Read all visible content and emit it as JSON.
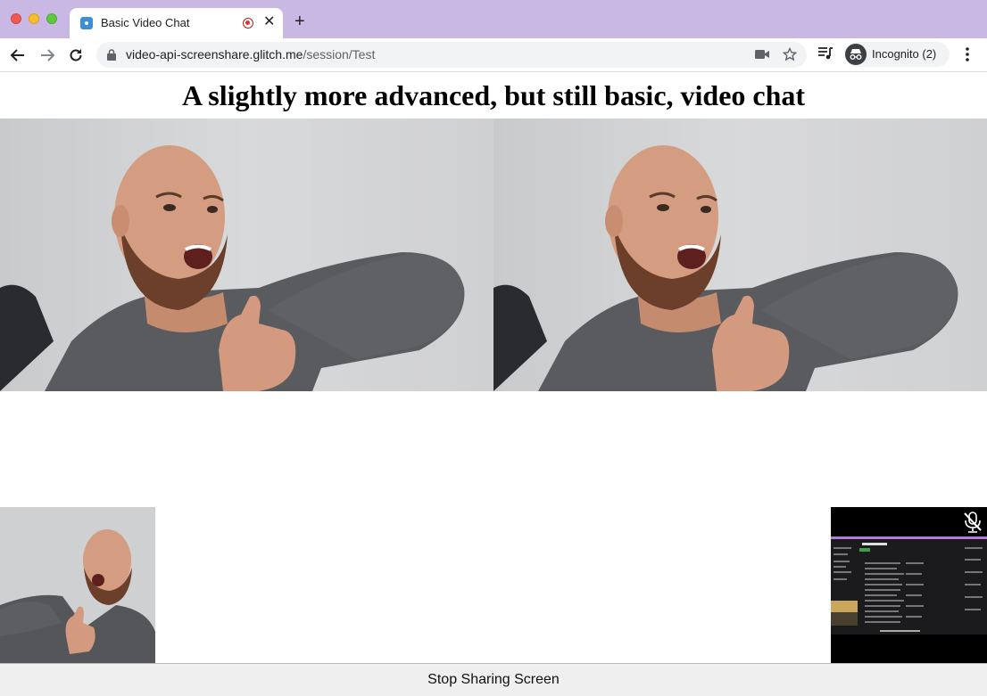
{
  "browser": {
    "tab_title": "Basic Video Chat",
    "url_domain": "video-api-screenshare.glitch.me",
    "url_path": "/session/Test",
    "profile_label": "Incognito (2)"
  },
  "page": {
    "heading": "A slightly more advanced, but still basic, video chat",
    "stop_sharing_label": "Stop Sharing Screen"
  },
  "colors": {
    "titlebar": "#c9b8e3",
    "background": "#ffffff"
  }
}
